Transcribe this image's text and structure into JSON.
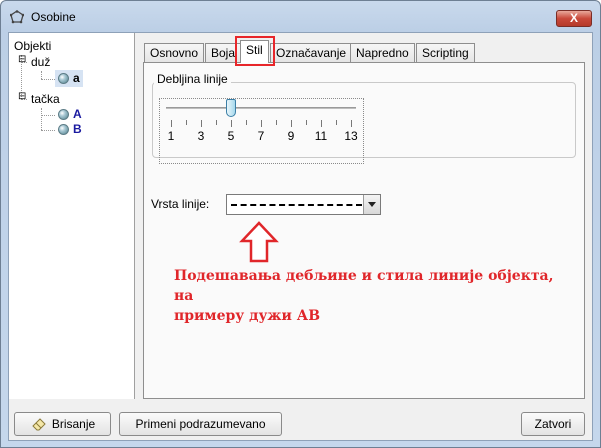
{
  "window": {
    "title": "Osobine",
    "close_label": "X"
  },
  "tree": {
    "root": "Objekti",
    "groups": [
      {
        "label": "duž",
        "items": [
          "a"
        ]
      },
      {
        "label": "tačka",
        "items": [
          "A",
          "B"
        ]
      }
    ]
  },
  "tabs": [
    "Osnovno",
    "Boja",
    "Stil",
    "Označavanje",
    "Napredno",
    "Scripting"
  ],
  "active_tab": "Stil",
  "style_tab": {
    "thickness_legend": "Debljina linije",
    "thickness_value": 5,
    "tick_labels": [
      "1",
      "3",
      "5",
      "7",
      "9",
      "11",
      "13"
    ],
    "line_type_label": "Vrsta linije:",
    "line_type_value": "dashed"
  },
  "annotation": {
    "text_line1": "Подешавања дебљине и стила линије објекта, на",
    "text_line2": "примеру дужи АВ",
    "color": "#e0262a"
  },
  "footer": {
    "delete_label": "Brisanje",
    "apply_default_label": "Primeni podrazumevano",
    "close_label": "Zatvori"
  }
}
